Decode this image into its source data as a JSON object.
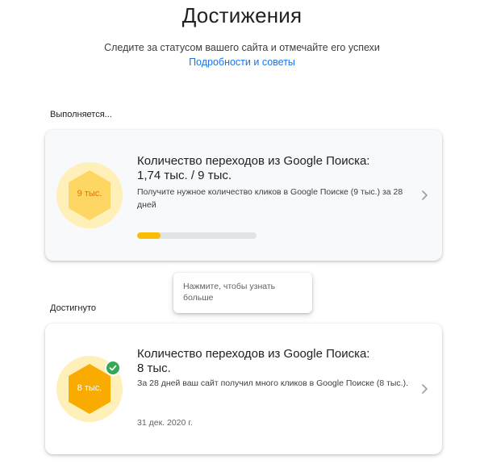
{
  "header": {
    "title": "Достижения",
    "subtitle": "Следите за статусом вашего сайта и отмечайте его успехи",
    "details_link": "Подробности и советы"
  },
  "sections": {
    "in_progress_label": "Выполняется...",
    "achieved_label": "Достигнуто"
  },
  "in_progress_card": {
    "badge_text": "9 тыс.",
    "title_line1": "Количество переходов из Google Поиска:",
    "title_line2": "1,74 тыс. / 9 тыс.",
    "description": "Получите нужное количество кликов в Google Поиске (9 тыс.) за 28 дней",
    "progress_fraction": 0.193,
    "icon": "chevron-right-icon"
  },
  "tooltip": {
    "text": "Нажмите, чтобы узнать больше"
  },
  "achieved_card": {
    "badge_text": "8 тыс.",
    "title_line1": "Количество переходов из Google Поиска:",
    "title_line2": "8 тыс.",
    "description": "За 28 дней ваш сайт получил много кликов в Google Поиске (8 тыс.).",
    "date": "31 дек. 2020 г.",
    "check_icon": "checkmark-icon",
    "icon": "chevron-right-icon"
  },
  "colors": {
    "accent_link": "#1a73e8",
    "badge_light": "#fef0b8",
    "hex_progress": "#fdd663",
    "hex_achieved": "#f9ab00",
    "progress_fill": "#fbbc04",
    "check_green": "#34a853"
  }
}
